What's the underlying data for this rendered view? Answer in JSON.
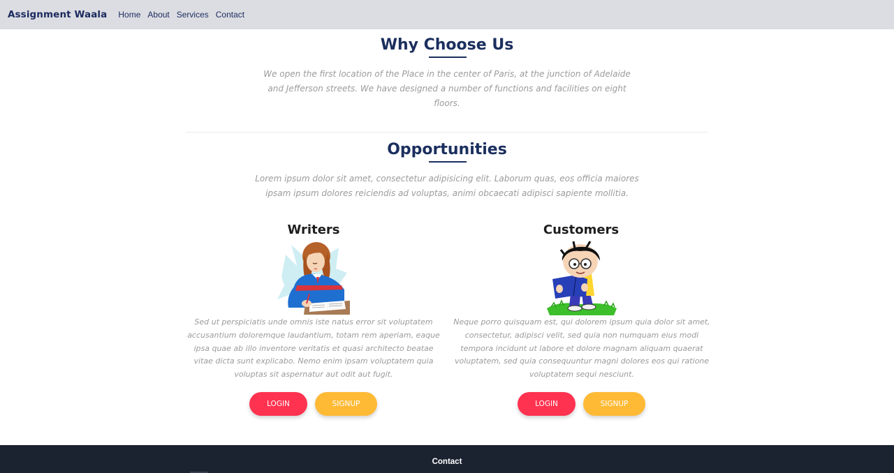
{
  "navbar": {
    "brand": "Assignment Waala",
    "links": [
      "Home",
      "About",
      "Services",
      "Contact"
    ]
  },
  "why_choose_us": {
    "title": "Why Choose Us",
    "text": "We open the first location of the Place in the center of Paris, at the junction of Adelaide and Jefferson streets. We have designed a number of functions and facilities on eight floors."
  },
  "opportunities": {
    "title": "Opportunities",
    "text": "Lorem ipsum dolor sit amet, consectetur adipisicing elit. Laborum quas, eos officia maiores ipsam ipsum dolores reiciendis ad voluptas, animi obcaecati adipisci sapiente mollitia.",
    "cards": [
      {
        "title": "Writers",
        "image_icon": "writer-illustration-icon",
        "text": "Sed ut perspiciatis unde omnis iste natus error sit voluptatem accusantium doloremque laudantium, totam rem aperiam, eaque ipsa quae ab illo inventore veritatis et quasi architecto beatae vitae dicta sunt explicabo. Nemo enim ipsam voluptatem quia voluptas sit aspernatur aut odit aut fugit.",
        "login_label": "LOGIN",
        "signup_label": "SIGNUP"
      },
      {
        "title": "Customers",
        "image_icon": "customer-illustration-icon",
        "text": "Neque porro quisquam est, qui dolorem ipsum quia dolor sit amet, consectetur, adipisci velit, sed quia non numquam eius modi tempora incidunt ut labore et dolore magnam aliquam quaerat voluptatem, sed quia consequuntur magni dolores eos qui ratione voluptatem sequi nesciunt.",
        "login_label": "LOGIN",
        "signup_label": "SIGNUP"
      }
    ]
  },
  "footer": {
    "title": "Contact"
  },
  "colors": {
    "navbar_bg": "#dcdde2",
    "heading": "#1b2f5e",
    "muted_text": "#9b9b9b",
    "login_button": "#ff3350",
    "signup_button": "#ffba35",
    "footer_bg": "#1b2230"
  }
}
